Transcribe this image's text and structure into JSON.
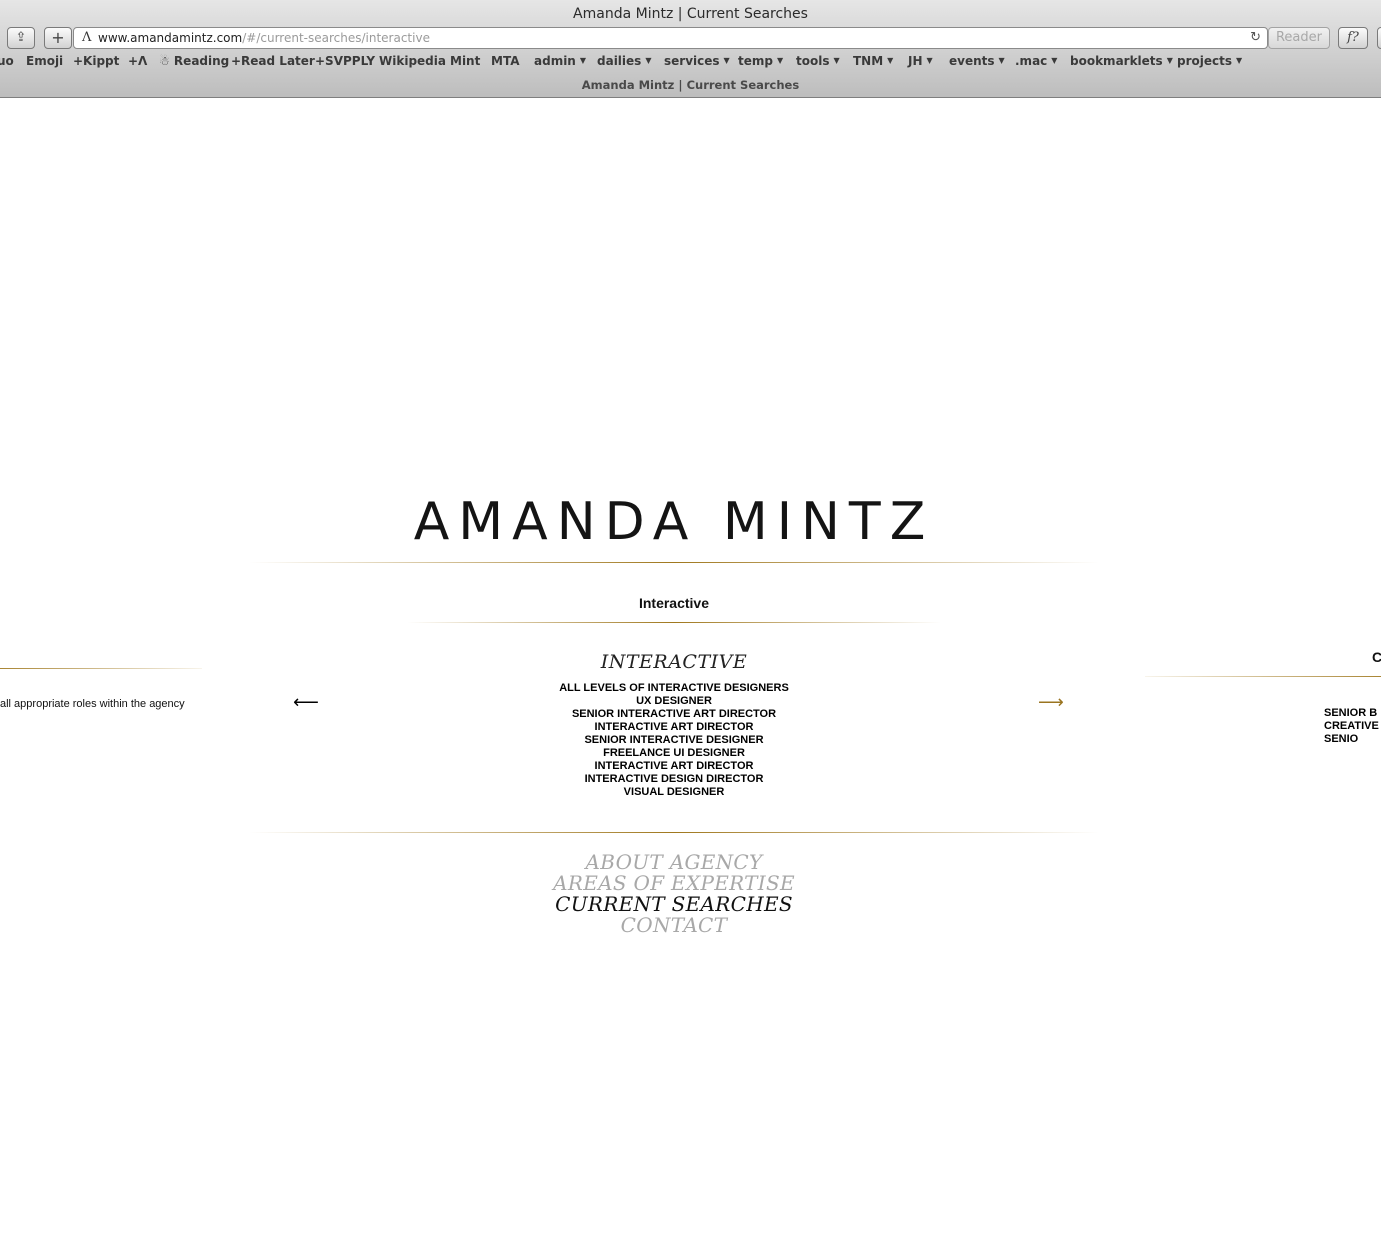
{
  "browser": {
    "window_title": "Amanda Mintz | Current Searches",
    "url_host": "www.amandamintz.com",
    "url_path": "/#/current-searches/interactive",
    "reader_label": "Reader",
    "bookmarks": [
      {
        "label": "uo",
        "menu": false
      },
      {
        "label": "Emoji",
        "menu": false
      },
      {
        "label": "+Kippt",
        "menu": false
      },
      {
        "label": "+Λ",
        "menu": false
      },
      {
        "label": "☃ Reading",
        "menu": false
      },
      {
        "label": "+Read Later",
        "menu": false
      },
      {
        "label": "+SVPPLY",
        "menu": false
      },
      {
        "label": "Wikipedia",
        "menu": false
      },
      {
        "label": "Mint",
        "menu": false
      },
      {
        "label": "MTA",
        "menu": false
      },
      {
        "label": "admin",
        "menu": true
      },
      {
        "label": "dailies",
        "menu": true
      },
      {
        "label": "services",
        "menu": true
      },
      {
        "label": "temp",
        "menu": true
      },
      {
        "label": "tools",
        "menu": true
      },
      {
        "label": "TNM",
        "menu": true
      },
      {
        "label": "JH",
        "menu": true
      },
      {
        "label": "events",
        "menu": true
      },
      {
        "label": ".mac",
        "menu": true
      },
      {
        "label": "bookmarklets",
        "menu": true
      },
      {
        "label": "projects",
        "menu": true
      }
    ],
    "tab_title": "Amanda Mintz | Current Searches"
  },
  "page": {
    "logo": "AMANDA MINTZ",
    "section_title": "Interactive",
    "card_title": "INTERACTIVE",
    "roles": [
      "ALL LEVELS OF INTERACTIVE DESIGNERS",
      "UX DESIGNER",
      "SENIOR INTERACTIVE ART DIRECTOR",
      "INTERACTIVE ART DIRECTOR",
      "SENIOR INTERACTIVE DESIGNER",
      "FREELANCE UI DESIGNER",
      "INTERACTIVE ART DIRECTOR",
      "INTERACTIVE DESIGN DIRECTOR",
      "VISUAL DESIGNER"
    ],
    "prev_arrow": "⟵",
    "next_arrow": "⟶",
    "left_card_text": "all appropriate roles within the agency",
    "right_card_title": "C",
    "right_card_roles": [
      "SENIOR B",
      "CREATIVE",
      "SENIO"
    ],
    "nav": [
      {
        "label": "ABOUT AGENCY",
        "active": false
      },
      {
        "label": "AREAS OF EXPERTISE",
        "active": false
      },
      {
        "label": "CURRENT SEARCHES",
        "active": true
      },
      {
        "label": "CONTACT",
        "active": false
      }
    ]
  },
  "colors": {
    "gold": "#9a7420",
    "inactive_nav": "#a8a8a8",
    "active_nav": "#111111"
  }
}
